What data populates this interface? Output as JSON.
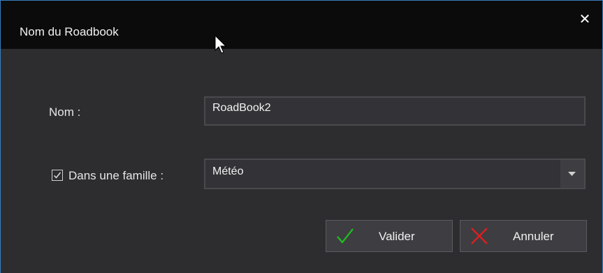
{
  "window": {
    "title": "Nom du Roadbook",
    "close_glyph": "✕"
  },
  "form": {
    "name_label": "Nom :",
    "name_value": "RoadBook2",
    "family_checkbox_checked": true,
    "family_label": "Dans une famille :",
    "family_value": "Météo"
  },
  "buttons": {
    "ok_label": "Valider",
    "cancel_label": "Annuler"
  },
  "icons": {
    "close": "close-icon",
    "check": "checkmark-icon",
    "dropdown": "chevron-down-icon",
    "ok": "green-check-icon",
    "cancel": "red-x-icon",
    "cursor": "mouse-pointer-icon"
  },
  "colors": {
    "ok_icon": "#1ec21e",
    "cancel_icon": "#e81c1c",
    "accent_border": "#3a7ebf"
  }
}
